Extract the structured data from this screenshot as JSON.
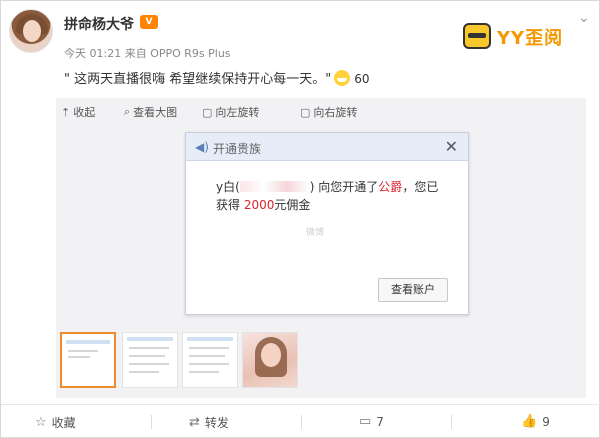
{
  "post": {
    "username": "拼命杨大爷",
    "badge": "V",
    "meta": "今天 01:21 来自 OPPO R9s Plus",
    "text": "\" 这两天直播很嗨 希望继续保持开心每一天。\"",
    "emoji_icon": "grin-emoji-icon",
    "emoji_count": "60"
  },
  "brand": {
    "logo_text": "YY歪阅"
  },
  "toolbar": {
    "collapse": "收起",
    "view_large": "查看大图",
    "rotate_left": "向左旋转",
    "rotate_right": "向右旋转"
  },
  "dialog": {
    "title": "开通贵族",
    "line1_prefix": "y白(",
    "line1_mid": ") 向您开通了",
    "line1_red": "公爵",
    "line1_suffix": "，您已",
    "line2_prefix": "获得 ",
    "line2_red": "2000",
    "line2_suffix": "元佣金",
    "watermark": "微博",
    "button": "查看账户"
  },
  "footer": {
    "favorite": "收藏",
    "repost": "转发",
    "comment_count": "7",
    "like_count": "9"
  },
  "colors": {
    "accent": "#f39800",
    "red_text": "#d9232d",
    "dialog_header": "#e6edf8"
  }
}
